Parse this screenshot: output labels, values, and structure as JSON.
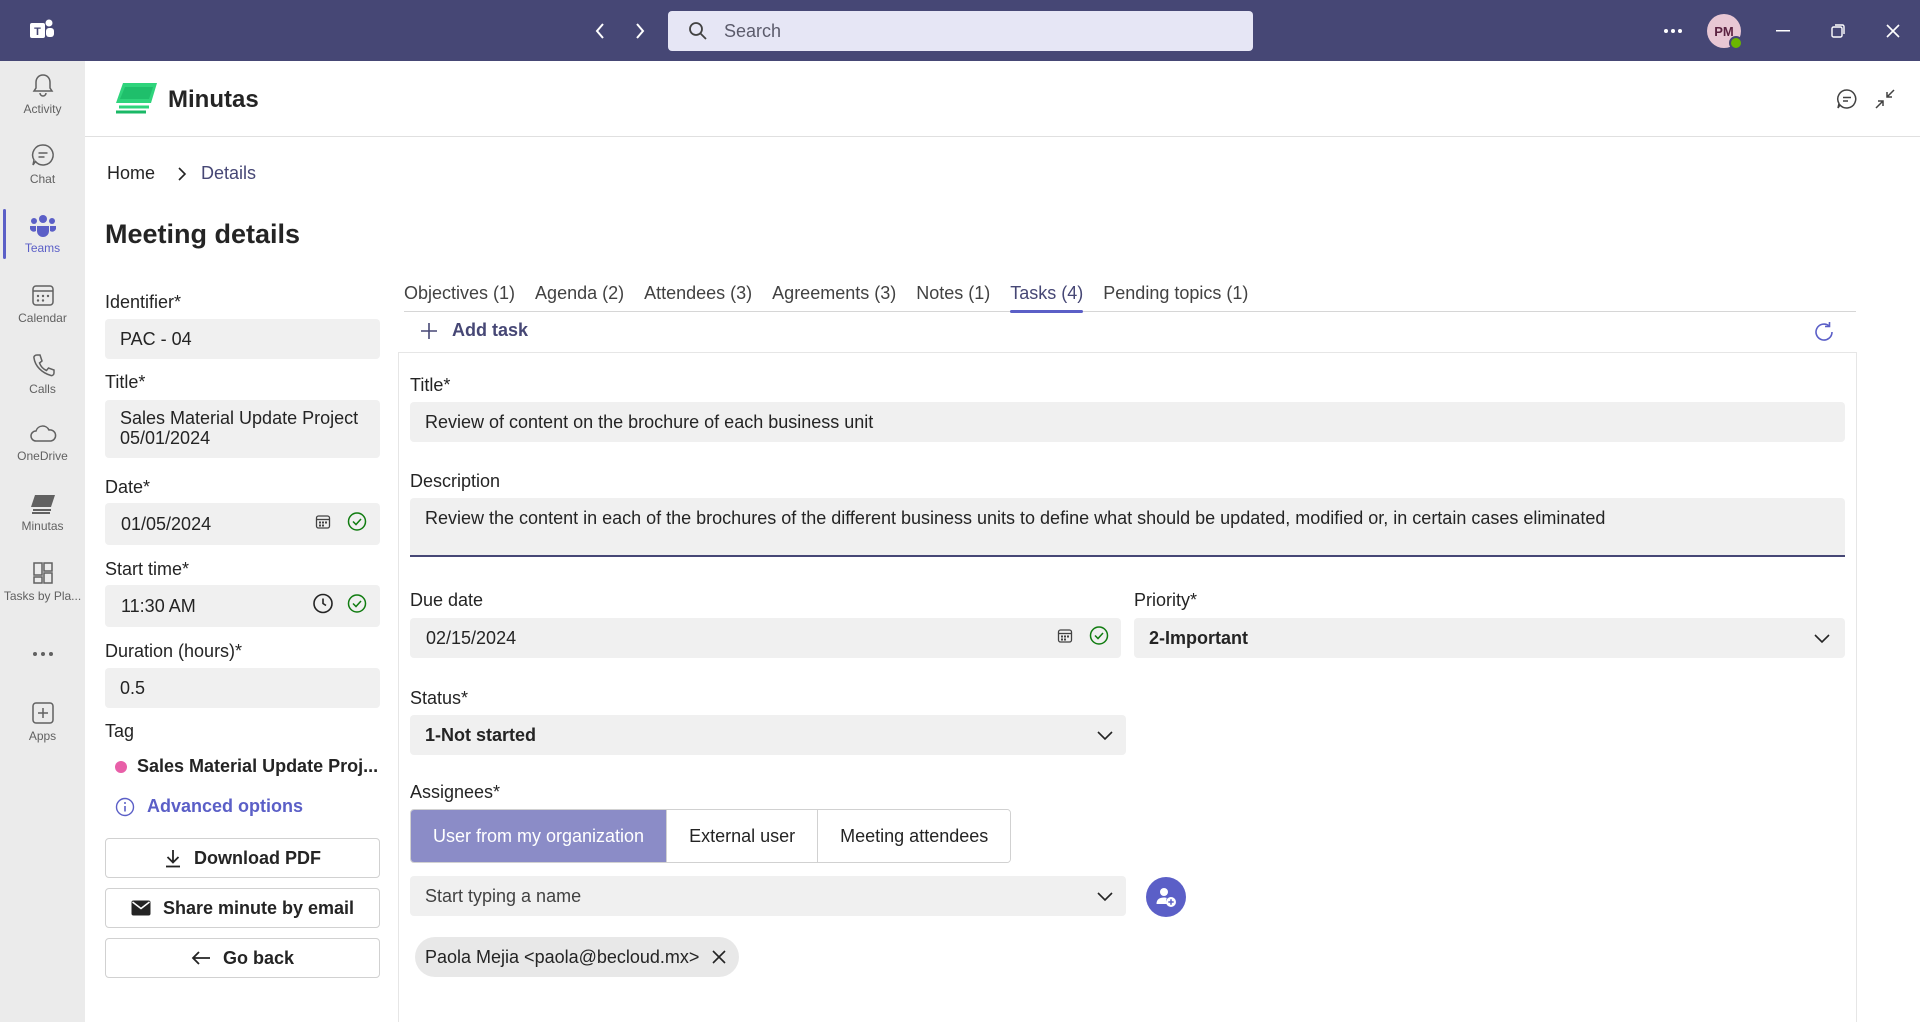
{
  "topbar": {
    "search_placeholder": "Search",
    "avatar_initials": "PM"
  },
  "rail": {
    "items": [
      {
        "label": "Activity",
        "icon": "bell-icon"
      },
      {
        "label": "Chat",
        "icon": "chat-icon"
      },
      {
        "label": "Teams",
        "icon": "teams-icon",
        "active": true
      },
      {
        "label": "Calendar",
        "icon": "calendar-icon"
      },
      {
        "label": "Calls",
        "icon": "phone-icon"
      },
      {
        "label": "OneDrive",
        "icon": "cloud-icon"
      },
      {
        "label": "Minutas",
        "icon": "minutas-icon"
      },
      {
        "label": "Tasks by Pla...",
        "icon": "tasks-icon"
      },
      {
        "label": "",
        "icon": "more-icon"
      },
      {
        "label": "Apps",
        "icon": "add-app-icon"
      }
    ]
  },
  "app": {
    "name": "Minutas"
  },
  "breadcrumb": {
    "home": "Home",
    "current": "Details"
  },
  "page_title": "Meeting details",
  "meeting": {
    "identifier_label": "Identifier*",
    "identifier_value": "PAC - 04",
    "title_label": "Title*",
    "title_value": "Sales Material Update Project 05/01/2024",
    "date_label": "Date*",
    "date_value": "01/05/2024",
    "start_label": "Start time*",
    "start_value": "11:30  AM",
    "duration_label": "Duration (hours)*",
    "duration_value": "0.5",
    "tag_label": "Tag",
    "tag_value": "Sales Material Update Proj...",
    "advanced_options": "Advanced options",
    "download_pdf": "Download PDF",
    "share_email": "Share minute by email",
    "go_back": "Go back"
  },
  "tabs": [
    {
      "label": "Objectives (1)"
    },
    {
      "label": "Agenda (2)"
    },
    {
      "label": "Attendees (3)"
    },
    {
      "label": "Agreements (3)"
    },
    {
      "label": "Notes (1)"
    },
    {
      "label": "Tasks (4)",
      "active": true
    },
    {
      "label": "Pending topics (1)"
    }
  ],
  "task_form": {
    "add_task": "Add task",
    "title_label": "Title*",
    "title_value": "Review of content on the brochure of each business unit",
    "description_label": "Description",
    "description_value": "Review the content in each of the brochures of the different business units to define what should be updated, modified or, in certain cases eliminated",
    "due_label": "Due date",
    "due_value": "02/15/2024",
    "priority_label": "Priority*",
    "priority_value": "2-Important",
    "status_label": "Status*",
    "status_value": "1-Not started",
    "assignees_label": "Assignees*",
    "assignee_options": [
      "User from my organization",
      "External user",
      "Meeting attendees"
    ],
    "assignee_selected": "User from my organization",
    "people_placeholder": "Start typing a name",
    "assigned_person": "Paola Mejia <paola@becloud.mx>"
  },
  "colors": {
    "topbar": "#464775",
    "accent": "#5b5fc7",
    "segment_active": "#8b8cc7",
    "tag_dot": "#e85fa8",
    "success_check": "#107c10"
  }
}
